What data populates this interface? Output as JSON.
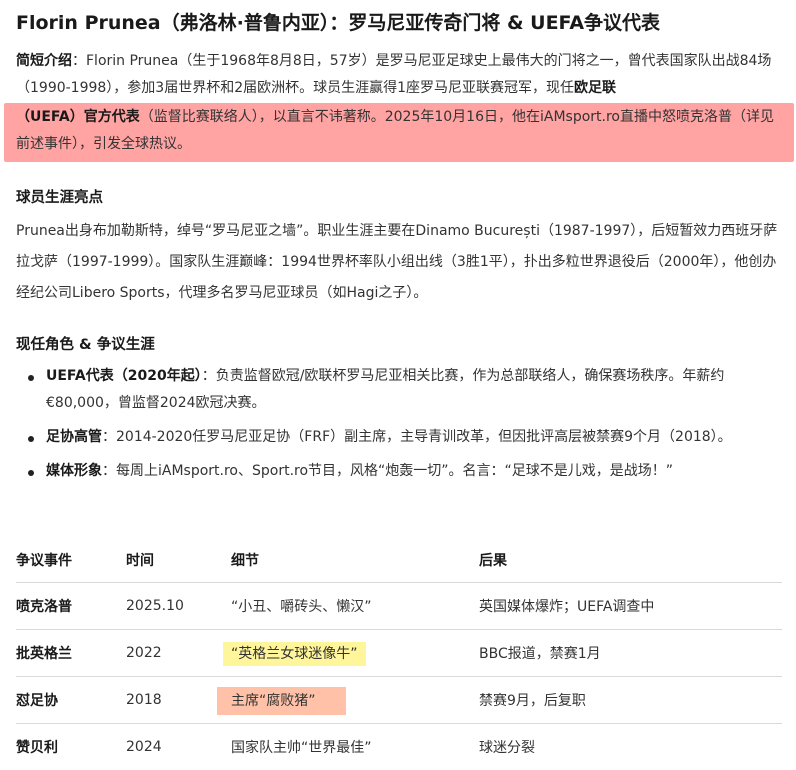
{
  "title": "Florin Prunea（弗洛林·普鲁内亚）：罗马尼亚传奇门将 & UEFA争议代表",
  "intro": {
    "label": "简短介绍",
    "text1": "：Florin Prunea（生于1968年8月8日，57岁）是罗马尼亚足球史上最伟大的门将之一，曾代表国家队出战84场（1990-1998），参加3届世界杯和2届欧洲杯。球员生涯赢得1座罗马尼亚联赛冠军，现任",
    "bold1": "欧足联",
    "bold2": "（UEFA）官方代表",
    "text2": "（监督比赛联络人），以直言不讳著称。2025年10月16日，他在iAMsport.ro直播中怒喷克洛普（详见前述事件），引发全球热议。"
  },
  "career": {
    "heading": "球员生涯亮点",
    "text": "Prunea出身布加勒斯特，绰号“罗马尼亚之墙”。职业生涯主要在Dinamo București（1987-1997），后短暂效力西班牙萨拉戈萨（1997-1999）。国家队生涯巅峰：1994世界杯率队小组出线（3胜1平），扑出多粒世界退役后（2000年），他创办经纪公司Libero Sports，代理多名罗马尼亚球员（如Hagi之子）。"
  },
  "roles": {
    "heading": "现任角色 & 争议生涯",
    "items": [
      {
        "label": "UEFA代表（2020年起）",
        "text": "：负责监督欧冠/欧联杯罗马尼亚相关比赛，作为总部联络人，确保赛场秩序。年薪约€80,000，曾监督2024欧冠决赛。"
      },
      {
        "label": "足协高管",
        "text": "：2014-2020任罗马尼亚足协（FRF）副主席，主导青训改革，但因批评高层被禁赛9个月（2018）。"
      },
      {
        "label": "媒体形象",
        "text": "：每周上iAMsport.ro、Sport.ro节目，风格“炮轰一切”。名言：“足球不是儿戏，是战场！”"
      }
    ]
  },
  "table": {
    "headers": [
      "争议事件",
      "时间",
      "细节",
      "后果"
    ],
    "rows": [
      {
        "event": "喷克洛普",
        "time": "2025.10",
        "detail": "“小丑、嚼砖头、懒汉”",
        "result": "英国媒体爆炸；UEFA调查中",
        "mark": ""
      },
      {
        "event": "批英格兰",
        "time": "2022",
        "detail": "“英格兰女球迷像牛”",
        "result": "BBC报道，禁赛1月",
        "mark": "yellow"
      },
      {
        "event": "怼足协",
        "time": "2018",
        "detail": "主席“腐败猪”",
        "result": "禁赛9月，后复职",
        "mark": "orange"
      },
      {
        "event": "赞贝利",
        "time": "2024",
        "detail": "国家队主帅“世界最佳”",
        "result": "球迷分裂",
        "mark": ""
      }
    ]
  },
  "colors": {
    "highlight_red": "#ffa3a3",
    "highlight_yellow": "#fff59a",
    "highlight_orange": "#ffc2a8"
  }
}
